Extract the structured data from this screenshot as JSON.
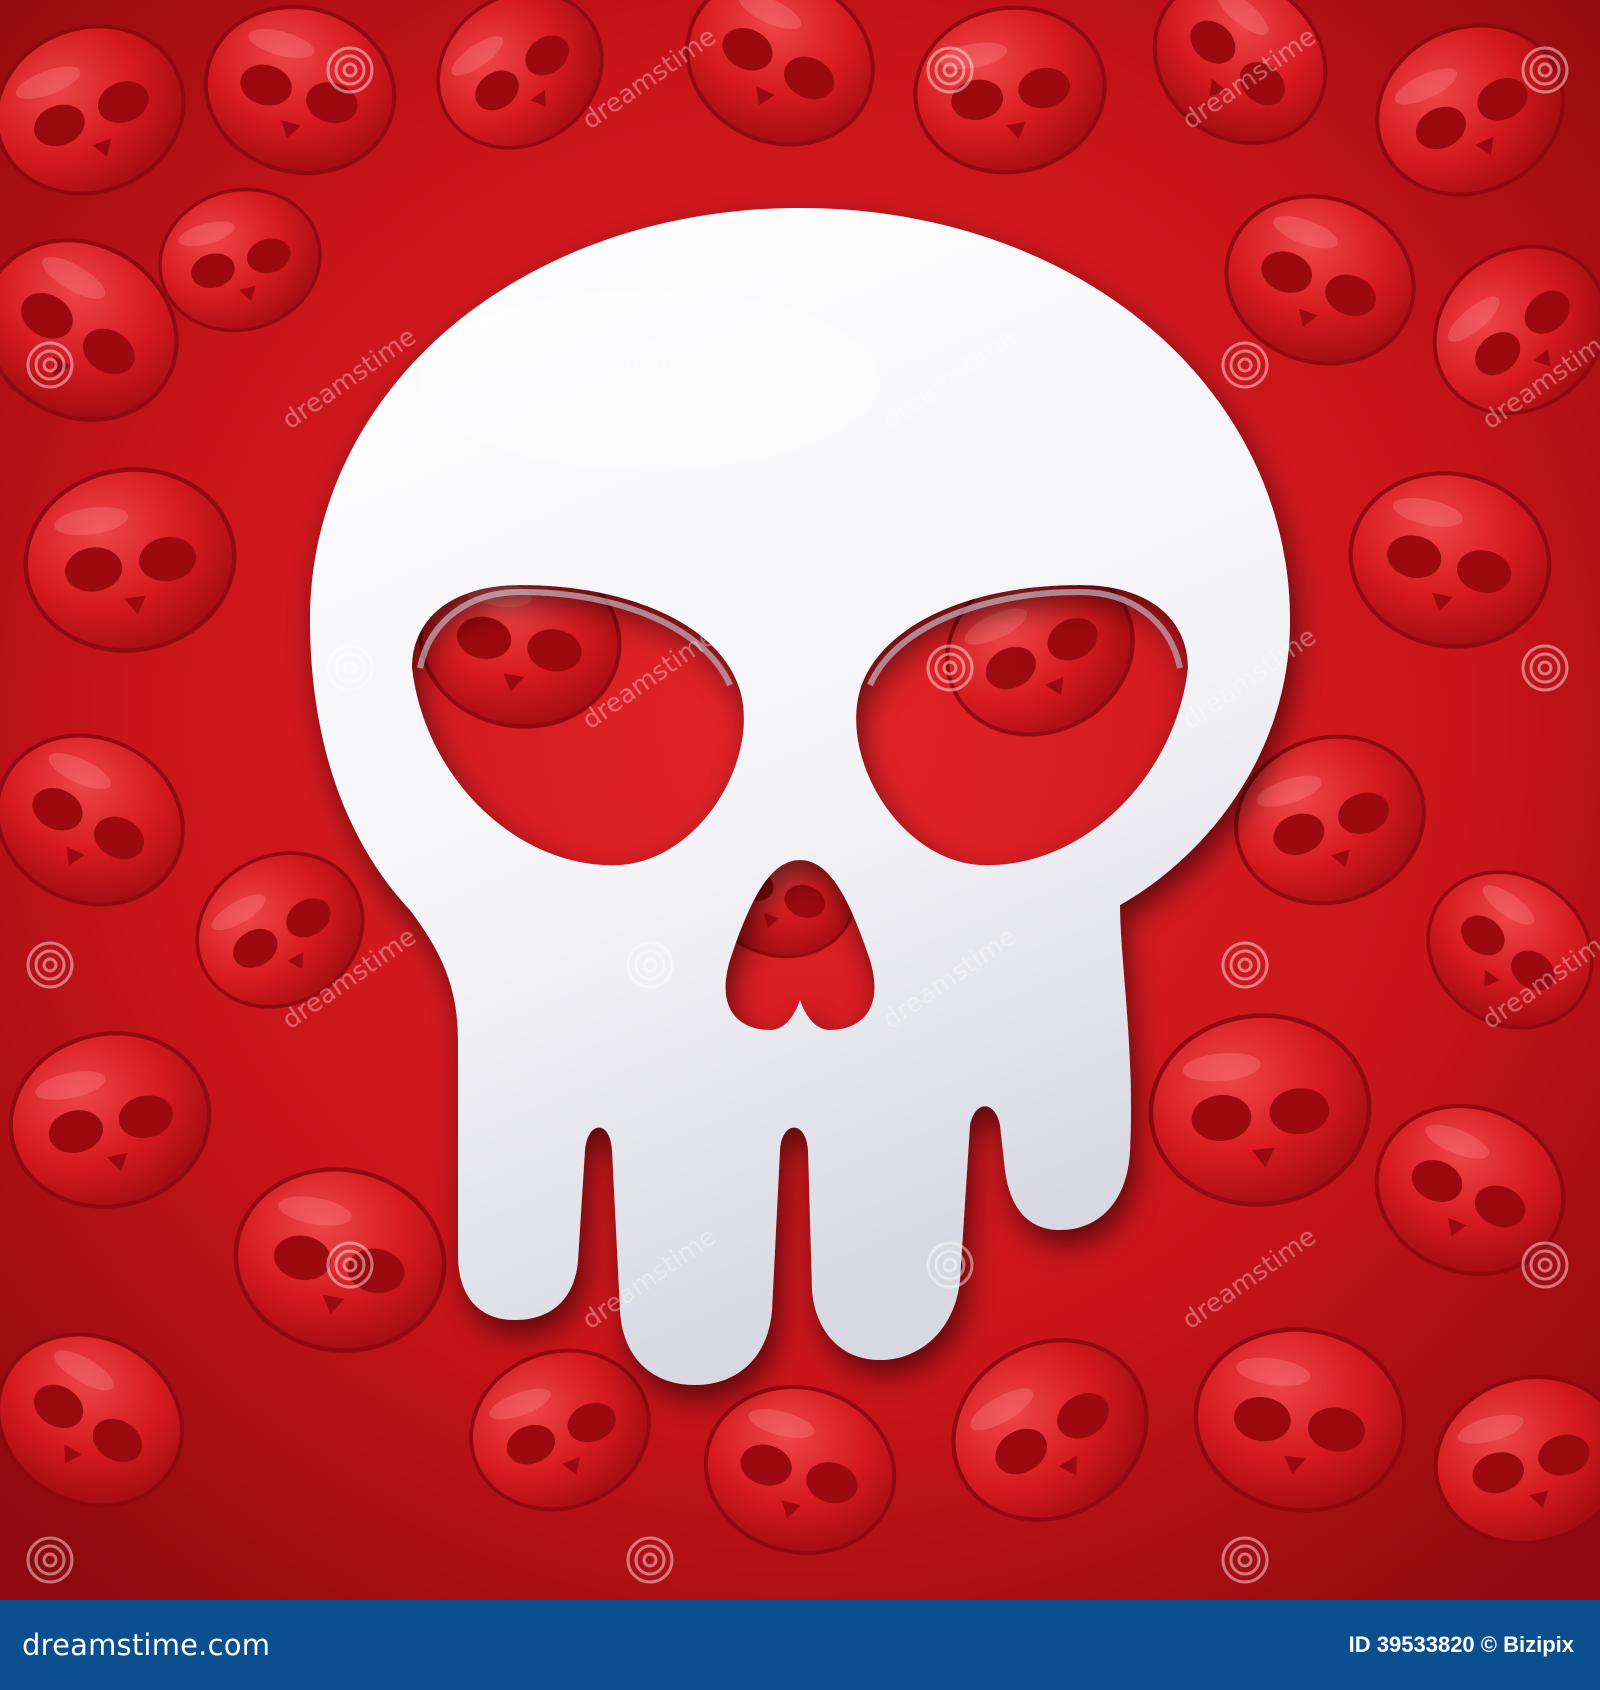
{
  "image": {
    "subject": "white-skull-icon",
    "background": "red-skulls-pile",
    "colors": {
      "background_red": "#c8141a",
      "skull_white": "#f4f4f8",
      "footer_blue": "#0c4f8e"
    }
  },
  "watermark": {
    "text": "dreamstime"
  },
  "footer": {
    "site_label": "dreamstime.com",
    "credit": "ID 39533820 © Bizipix"
  }
}
